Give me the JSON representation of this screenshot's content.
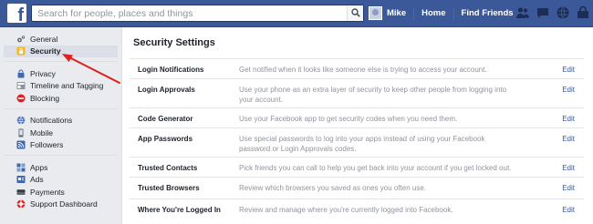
{
  "topbar": {
    "logo": "f",
    "search_placeholder": "Search for people, places and things",
    "user_name": "Mike",
    "home_label": "Home",
    "find_friends_label": "Find Friends",
    "brand_color": "#3b5998"
  },
  "sidebar": {
    "groups": [
      [
        {
          "label": "General",
          "icon": "gear-icon"
        },
        {
          "label": "Security",
          "icon": "lock-icon",
          "active": true
        }
      ],
      [
        {
          "label": "Privacy",
          "icon": "privacy-lock-icon"
        },
        {
          "label": "Timeline and Tagging",
          "icon": "timeline-icon"
        },
        {
          "label": "Blocking",
          "icon": "block-icon"
        }
      ],
      [
        {
          "label": "Notifications",
          "icon": "globe-icon"
        },
        {
          "label": "Mobile",
          "icon": "mobile-icon"
        },
        {
          "label": "Followers",
          "icon": "rss-icon"
        }
      ],
      [
        {
          "label": "Apps",
          "icon": "apps-icon"
        },
        {
          "label": "Ads",
          "icon": "ads-icon"
        },
        {
          "label": "Payments",
          "icon": "payments-icon"
        },
        {
          "label": "Support Dashboard",
          "icon": "support-icon"
        }
      ]
    ]
  },
  "main": {
    "title": "Security Settings",
    "edit_label": "Edit",
    "rows": [
      {
        "label": "Login Notifications",
        "desc": "Get notified when it looks like someone else is trying to access your account."
      },
      {
        "label": "Login Approvals",
        "desc": "Use your phone as an extra layer of security to keep other people from logging into your account."
      },
      {
        "label": "Code Generator",
        "desc": "Use your Facebook app to get security codes when you need them."
      },
      {
        "label": "App Passwords",
        "desc": "Use special passwords to log into your apps instead of using your Facebook password or Login Approvals codes."
      },
      {
        "label": "Trusted Contacts",
        "desc": "Pick friends you can call to help you get back into your account if you get locked out."
      },
      {
        "label": "Trusted Browsers",
        "desc": "Review which browsers you saved as ones you often use."
      },
      {
        "label": "Where You're Logged In",
        "desc": "Review and manage where you're currently logged into Facebook."
      }
    ]
  },
  "annotation_color": "#e0201e"
}
